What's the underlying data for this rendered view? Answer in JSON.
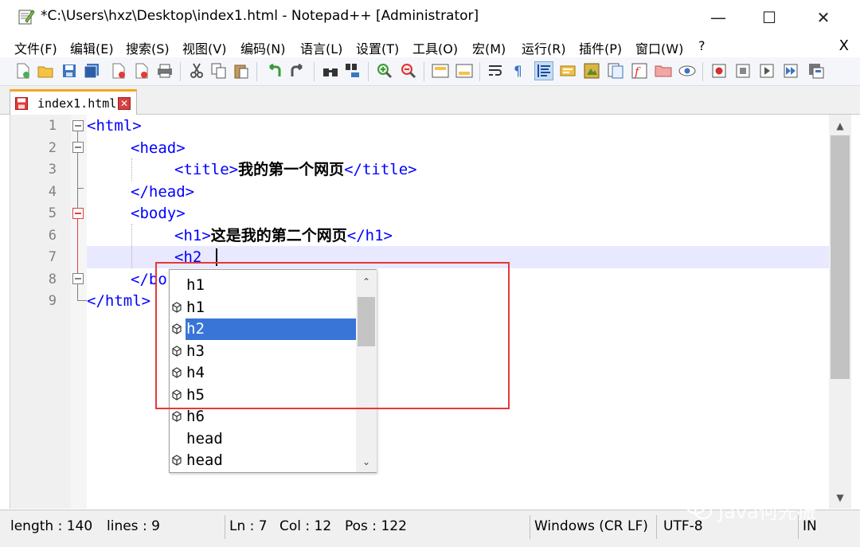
{
  "window": {
    "title": "*C:\\Users\\hxz\\Desktop\\index1.html - Notepad++ [Administrator]",
    "minimize": "—",
    "maximize": "☐",
    "close": "✕"
  },
  "menu": {
    "items": [
      "文件(F)",
      "编辑(E)",
      "搜索(S)",
      "视图(V)",
      "编码(N)",
      "语言(L)",
      "设置(T)",
      "工具(O)",
      "宏(M)",
      "运行(R)",
      "插件(P)",
      "窗口(W)",
      "?"
    ],
    "close": "X"
  },
  "tab": {
    "label": "index1.html",
    "close": "✕"
  },
  "editor": {
    "line_numbers": [
      "1",
      "2",
      "3",
      "4",
      "5",
      "6",
      "7",
      "8",
      "9"
    ],
    "lines": [
      {
        "indent": "",
        "parts": [
          "<html>"
        ]
      },
      {
        "indent": "    ",
        "parts": [
          "<head>"
        ]
      },
      {
        "indent": "        ",
        "parts": [
          "<title>",
          "我的第一个网页",
          "</title>"
        ]
      },
      {
        "indent": "    ",
        "parts": [
          "</head>"
        ]
      },
      {
        "indent": "    ",
        "parts": [
          "<body>"
        ]
      },
      {
        "indent": "        ",
        "parts": [
          "<h1>",
          "这是我的第二个网页",
          "</h1>"
        ]
      },
      {
        "indent": "        ",
        "parts": [
          "<h2"
        ]
      },
      {
        "indent": "    ",
        "parts": [
          "</bo"
        ]
      },
      {
        "indent": "",
        "parts": [
          "</html>"
        ]
      }
    ]
  },
  "autocomplete": {
    "items": [
      {
        "label": "h1",
        "icon": false
      },
      {
        "label": "h1",
        "icon": true
      },
      {
        "label": "h2",
        "icon": true,
        "selected": true
      },
      {
        "label": "h3",
        "icon": true
      },
      {
        "label": "h4",
        "icon": true
      },
      {
        "label": "h5",
        "icon": true
      },
      {
        "label": "h6",
        "icon": true
      },
      {
        "label": "head",
        "icon": false
      },
      {
        "label": "head",
        "icon": true
      }
    ]
  },
  "status": {
    "length": "length : 140",
    "lines": "lines : 9",
    "ln": "Ln : 7",
    "col": "Col : 12",
    "pos": "Pos : 122",
    "eol": "Windows (CR LF)",
    "encoding": "UTF-8",
    "mode": "IN"
  },
  "watermark": "Java何先振"
}
